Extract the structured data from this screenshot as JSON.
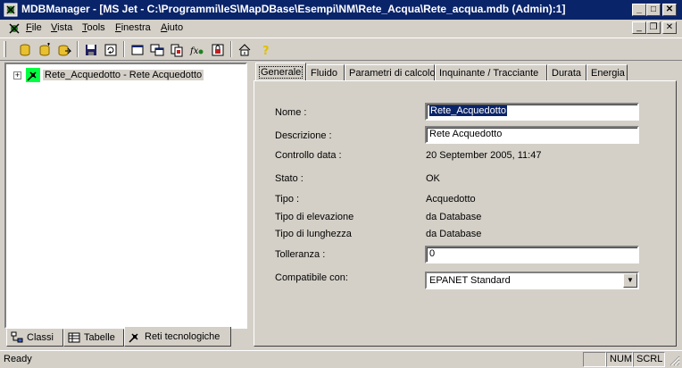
{
  "window": {
    "title": "MDBManager - [MS Jet - C:\\Programmi\\IeS\\MapDBase\\Esempi\\NM\\Rete_Acqua\\Rete_acqua.mdb (Admin):1]",
    "controls": {
      "minimize": "_",
      "maximize": "□",
      "close": "✕",
      "restore": "❐"
    }
  },
  "menu": {
    "items": [
      {
        "label": "File",
        "underline_char": "F"
      },
      {
        "label": "Vista",
        "underline_char": "V"
      },
      {
        "label": "Tools",
        "underline_char": "T"
      },
      {
        "label": "Finestra",
        "underline_char": "F"
      },
      {
        "label": "Aiuto",
        "underline_char": "A"
      }
    ]
  },
  "toolbar": {
    "buttons": [
      "db-open-icon",
      "db-new-icon",
      "db-export-icon",
      "save-icon",
      "refresh-icon",
      "window-icon",
      "windows-icon",
      "copy-window-icon",
      "function-icon",
      "lock-icon",
      "home-icon",
      "help-icon"
    ]
  },
  "tree": {
    "expander": "+",
    "root_label": "Rete_Acquedotto - Rete Acquedotto"
  },
  "left_tabs": [
    {
      "label": "Classi",
      "icon": "classes-icon"
    },
    {
      "label": "Tabelle",
      "icon": "table-icon"
    },
    {
      "label": "Reti tecnologiche",
      "icon": "network-icon"
    }
  ],
  "tabs": [
    "Generale",
    "Fluido",
    "Parametri di calcolo",
    "Inquinante / Tracciante",
    "Durata",
    "Energia"
  ],
  "form": {
    "nome_label": "Nome :",
    "nome_value": "Rete_Acquedotto",
    "descrizione_label": "Descrizione :",
    "descrizione_value": "Rete Acquedotto",
    "controllo_label": "Controllo data :",
    "controllo_value": "20 September 2005, 11:47",
    "stato_label": "Stato :",
    "stato_value": "OK",
    "tipo_label": "Tipo :",
    "tipo_value": "Acquedotto",
    "elevazione_label": "Tipo di elevazione",
    "elevazione_value": "da Database",
    "lunghezza_label": "Tipo di lunghezza",
    "lunghezza_value": "da Database",
    "tolleranza_label": "Tolleranza :",
    "tolleranza_value": "0",
    "compatibile_label": "Compatibile con:",
    "compatibile_value": "EPANET Standard",
    "dropdown_arrow": "▼"
  },
  "status": {
    "text": "Ready",
    "num": "NUM",
    "scrl": "SCRL"
  }
}
